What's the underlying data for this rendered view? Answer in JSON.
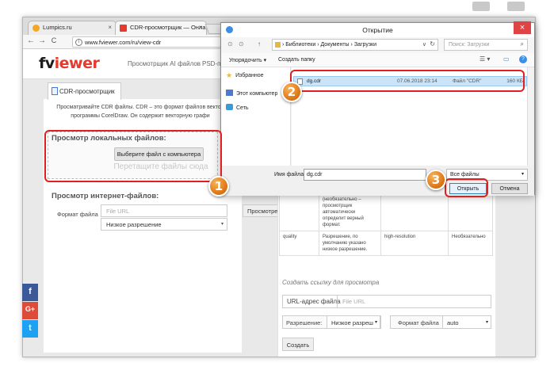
{
  "browser": {
    "tabs": [
      {
        "title": "Lumpics.ru",
        "favicon_color": "#f5a623"
      },
      {
        "title": "CDR-просмотрщик — Онла",
        "favicon_color": "#e53a2d"
      }
    ],
    "back_glyph": "←",
    "forward_glyph": "→",
    "reload_glyph": "C",
    "info_glyph": "i",
    "close_glyph": "×",
    "url": "www.fviewer.com/ru/view-cdr"
  },
  "site": {
    "logo_main": "fv",
    "logo_accent": "iewer",
    "nav": [
      "Просмотрщик AI файлов",
      "PSD-пр"
    ],
    "tab_label": "CDR-просмотрщик",
    "description_line1": "Просматривайте CDR файлы. CDR – это формат файлов вектор",
    "description_line2": "программы CorelDraw. Он содержит векторную графи",
    "local": {
      "title": "Просмотр локальных файлов:",
      "choose_button": "Выберите файл с компьютера",
      "drop_hint": "Перетащите файлы сюда"
    },
    "internet": {
      "title": "Просмотр интернет-файлов:",
      "format_label": "Формат файла",
      "url_placeholder": "File URL",
      "resolution_value": "Низкое разрешение",
      "view_button": "Просмотреть"
    },
    "param_table": [
      [
        "",
        "(необязательно – просмотрщик автоматически определит верный формат.",
        "",
        ""
      ],
      [
        "quality",
        "Разрешение, по умолчанию указано низкое разрешение.",
        "high-resolution",
        "Необязательно"
      ]
    ],
    "link_section": {
      "title": "Создать ссылку для просмотра",
      "url_label": "URL-адрес файла",
      "url_placeholder": "File URL",
      "resolution_label": "Разрешение:",
      "resolution_value": "Низкое разреш",
      "format_label": "Формат файла",
      "format_value": "auto",
      "create_button": "Создать"
    },
    "social": [
      {
        "glyph": "f",
        "color": "#3b5998"
      },
      {
        "glyph": "G+",
        "color": "#dd4b39"
      },
      {
        "glyph": "t",
        "color": "#1da1f2"
      }
    ]
  },
  "dialog": {
    "title": "Открытие",
    "breadcrumb": [
      "Библиотеки",
      "Документы",
      "Загрузки"
    ],
    "breadcrumb_sep": "›",
    "path_chevron": "∨",
    "refresh_glyph": "↻",
    "search_glyph": "⌕",
    "nav_back": "⊙",
    "nav_forward": "⊙",
    "nav_up": "↑",
    "search_placeholder": "Поиск: Загрузки",
    "organize": "Упорядочить ▾",
    "new_folder": "Создать папку",
    "view_glyph": "☰ ▾",
    "preview_glyph": "▭",
    "help_glyph": "?",
    "favorites": "Избранное",
    "favorites_glyph": "★",
    "this_pc": "Этот компьютер",
    "network": "Сеть",
    "file": {
      "name": "dg.cdr",
      "date": "07.06.2018 23:14",
      "type": "Файл \"CDR\"",
      "size": "160 КБ"
    },
    "filename_label": "Имя файла:",
    "filename_value": "dg.cdr",
    "filetype_value": "Все файлы",
    "open_button": "Открыть",
    "cancel_button": "Отмена",
    "chevron": "▾",
    "close_glyph": "×"
  },
  "annotations": [
    "1",
    "2",
    "3"
  ],
  "colors": {
    "highlight": "#e02020",
    "badge": "#e07b1a",
    "logo_accent": "#e53a2d",
    "selected_row": "#cce4f7"
  }
}
